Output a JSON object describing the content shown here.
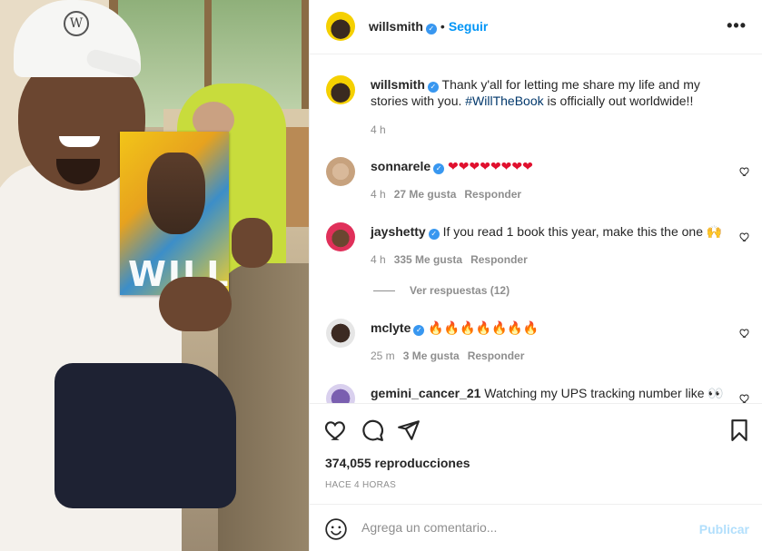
{
  "media": {
    "cap_logo": "W",
    "book_title": "WILL"
  },
  "header": {
    "username": "willsmith",
    "verified_mark": "✓",
    "separator": "•",
    "follow_label": "Seguir",
    "more_label": "•••"
  },
  "caption": {
    "username": "willsmith",
    "text_before": "Thank y'all for letting me share my life and my stories with you. ",
    "hashtag": "#WillTheBook",
    "text_after": " is officially out worldwide!!",
    "time": "4 h"
  },
  "comments": [
    {
      "username": "sonnarele",
      "text": "❤❤❤❤❤❤❤❤",
      "time": "4 h",
      "likes": "27 Me gusta",
      "reply": "Responder"
    },
    {
      "username": "jayshetty",
      "text": "If you read 1 book this year, make this the one 🙌",
      "time": "4 h",
      "likes": "335 Me gusta",
      "reply": "Responder",
      "view_replies": "Ver respuestas (12)"
    },
    {
      "username": "mclyte",
      "text": "🔥🔥🔥🔥🔥🔥🔥",
      "time": "25 m",
      "likes": "3 Me gusta",
      "reply": "Responder"
    },
    {
      "username": "gemini_cancer_21",
      "text": "Watching my UPS tracking number like 👀"
    }
  ],
  "actions": {
    "views": "374,055 reproducciones",
    "posted": "HACE 4 HORAS",
    "icons": [
      "heart-icon",
      "comment-icon",
      "share-icon",
      "bookmark-icon"
    ]
  },
  "add_comment": {
    "placeholder": "Agrega un comentario...",
    "publish_label": "Publicar"
  },
  "colors": {
    "link_blue": "#0095f6",
    "hashtag_blue": "#00376b",
    "muted": "#8e8e8e",
    "verified": "#3897f0"
  }
}
